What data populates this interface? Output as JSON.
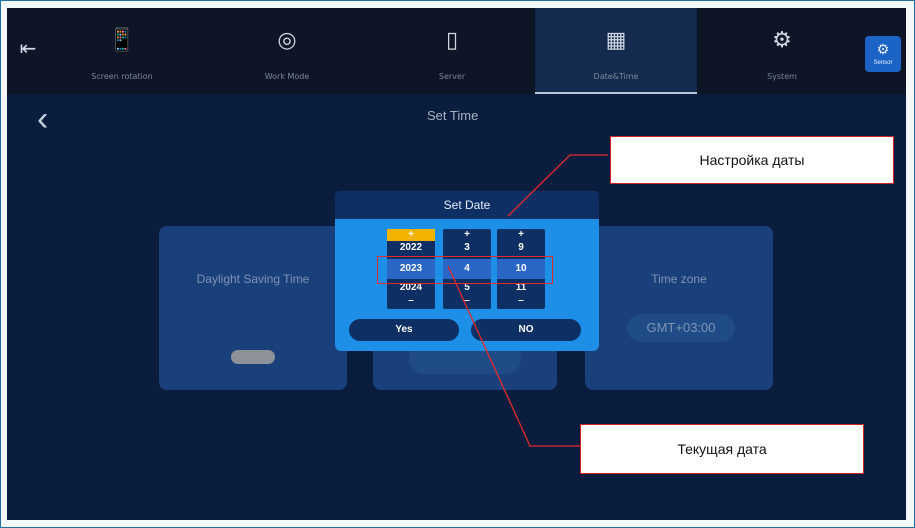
{
  "topbar": {
    "exit_icon": "exit-icon",
    "tabs": [
      {
        "label": "Screen rotation",
        "icon": "rotate-phone-icon"
      },
      {
        "label": "Work Mode",
        "icon": "ring-icon"
      },
      {
        "label": "Server",
        "icon": "server-icon"
      },
      {
        "label": "Date&Time",
        "icon": "calendar-icon"
      },
      {
        "label": "System",
        "icon": "gear-icon"
      }
    ],
    "active_tab": "Date&Time",
    "sensor_label": "Sensor"
  },
  "page": {
    "title": "Set Time"
  },
  "cards": {
    "daylight": {
      "title": "Daylight Saving Time",
      "toggle_state": "off"
    },
    "timezone": {
      "title": "Time zone",
      "value": "GMT+03:00"
    }
  },
  "dialog": {
    "title": "Set Date",
    "columns": [
      {
        "plus": "+",
        "prev": "2022",
        "current": "2023",
        "next": "2024",
        "minus": "–",
        "plus_highlight": true
      },
      {
        "plus": "+",
        "prev": "3",
        "current": "4",
        "next": "5",
        "minus": "–",
        "plus_highlight": false
      },
      {
        "plus": "+",
        "prev": "9",
        "current": "10",
        "next": "11",
        "minus": "–",
        "plus_highlight": false
      }
    ],
    "yes_label": "Yes",
    "no_label": "NO"
  },
  "annotations": {
    "date_setting": "Настройка даты",
    "current_date": "Текущая дата"
  },
  "colors": {
    "screen_bg": "#0a1d3f",
    "dialog_bg": "#1e8fe6",
    "plus_highlight": "#f1b200",
    "annotation_red": "#e52a2a"
  }
}
